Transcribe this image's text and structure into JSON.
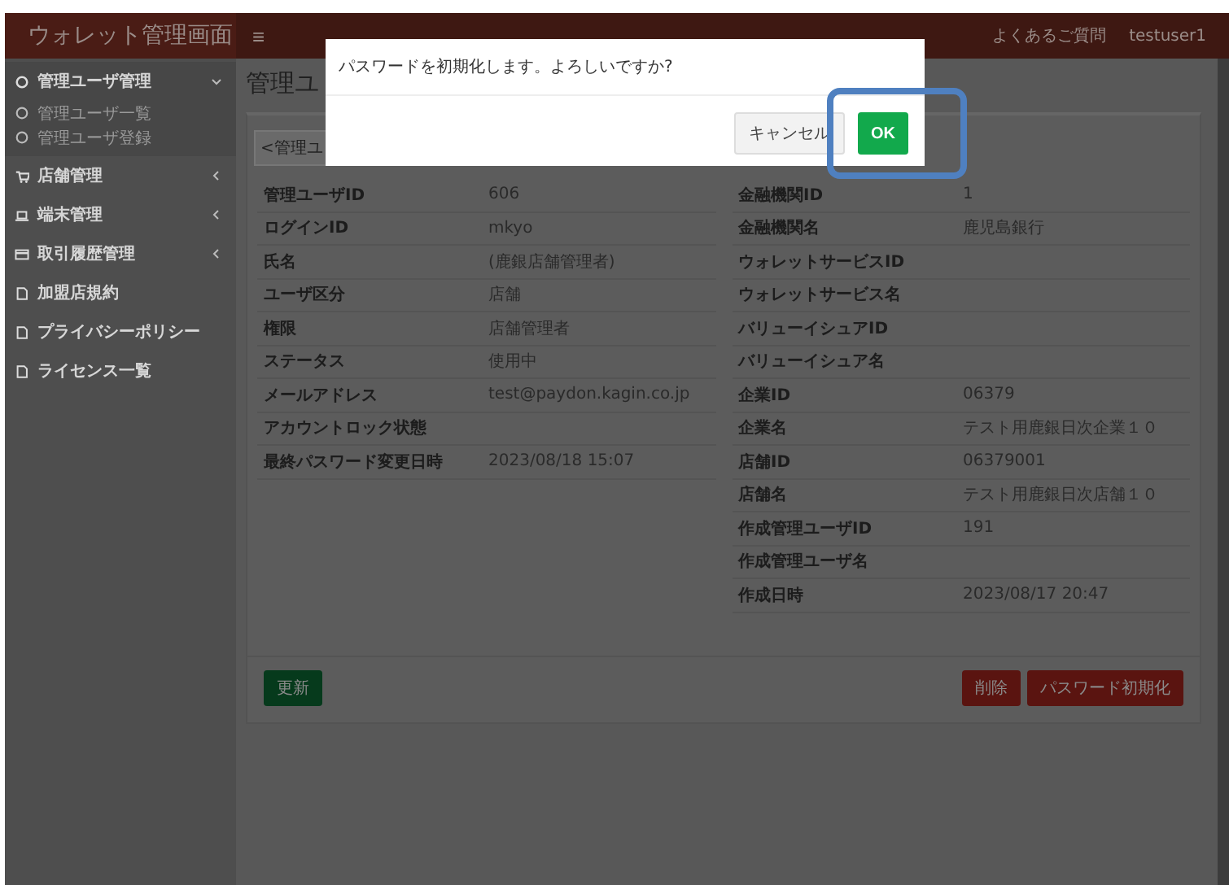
{
  "header": {
    "app_title": "ウォレット管理画面",
    "menu_icon": "≡",
    "links": [
      "よくあるご質問",
      "testuser1"
    ]
  },
  "sidebar": {
    "items": [
      {
        "label": "管理ユーザ管理",
        "expanded": true,
        "children": [
          {
            "label": "管理ユーザ一覧"
          },
          {
            "label": "管理ユーザ登録"
          }
        ]
      },
      {
        "label": "店舗管理",
        "expanded": false
      },
      {
        "label": "端末管理",
        "expanded": false
      },
      {
        "label": "取引履歴管理",
        "expanded": false
      },
      {
        "label": "加盟店規約"
      },
      {
        "label": "プライバシーポリシー"
      },
      {
        "label": "ライセンス一覧"
      }
    ]
  },
  "page": {
    "title": "管理ユ",
    "back_button": "<管理ユ"
  },
  "details_left": [
    {
      "label": "管理ユーザID",
      "value": "606"
    },
    {
      "label": "ログインID",
      "value": "mkyo"
    },
    {
      "label": "氏名",
      "value": "(鹿銀店舗管理者)"
    },
    {
      "label": "ユーザ区分",
      "value": "店舗"
    },
    {
      "label": "権限",
      "value": "店舗管理者"
    },
    {
      "label": "ステータス",
      "value": "使用中"
    },
    {
      "label": "メールアドレス",
      "value": "test@paydon.kagin.co.jp"
    },
    {
      "label": "アカウントロック状態"
    },
    {
      "label": "最終パスワード変更日時",
      "value": "2023/08/18 15:07"
    }
  ],
  "details_right": [
    {
      "label": "金融機関ID",
      "value": "1"
    },
    {
      "label": "金融機関名",
      "value": "鹿児島銀行"
    },
    {
      "label": "ウォレットサービスID"
    },
    {
      "label": "ウォレットサービス名"
    },
    {
      "label": "バリューイシュアID"
    },
    {
      "label": "バリューイシュア名"
    },
    {
      "label": "企業ID",
      "value": "06379"
    },
    {
      "label": "企業名",
      "value": "テスト用鹿銀日次企業１０"
    },
    {
      "label": "店舗ID",
      "value": "06379001"
    },
    {
      "label": "店舗名",
      "value": "テスト用鹿銀日次店舗１０"
    },
    {
      "label": "作成管理ユーザID",
      "value": "191"
    },
    {
      "label": "作成管理ユーザ名"
    },
    {
      "label": "作成日時",
      "value": "2023/08/17 20:47"
    }
  ],
  "footer_buttons": [
    {
      "label": "更新",
      "kind": "primary"
    },
    {
      "label": "削除",
      "kind": "danger"
    },
    {
      "label": "パスワード初期化",
      "kind": "danger"
    }
  ],
  "dialog": {
    "message": "パスワードを初期化します。よろしいですか?",
    "buttons": [
      {
        "label": "キャンセル",
        "kind": "secondary"
      },
      {
        "label": "OK",
        "kind": "primary"
      }
    ],
    "highlighted": true
  }
}
